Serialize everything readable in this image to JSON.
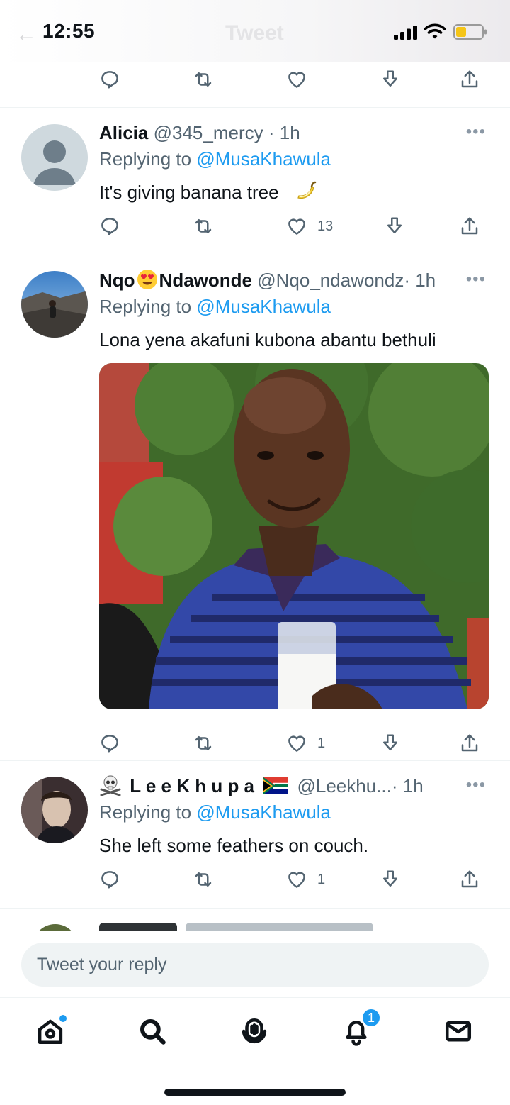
{
  "status_bar": {
    "time": "12:55",
    "ghost_title": "Tweet",
    "battery_color": "#f5c518"
  },
  "tweets": [
    {
      "name": "Alicia",
      "handle": "@345_mercy",
      "time": "· 1h",
      "replying_prefix": "Replying to",
      "replying_to": "@MusaKhawula",
      "text": "It's giving banana tree",
      "emoji_icon": "banana-icon",
      "like_count": "13"
    },
    {
      "name_part1": "Nqo",
      "name_part2": "Ndawonde",
      "name_emoji_icon": "heart-eyes-icon",
      "handle": "@Nqo_ndawondz",
      "time": "· 1h",
      "replying_prefix": "Replying to",
      "replying_to": "@MusaKhawula",
      "text": "Lona yena akafuni kubona abantu bethuli",
      "like_count": "1"
    },
    {
      "name": "L e e K h u p a",
      "name_prefix_icon": "skull-crossbones-icon",
      "name_suffix_icon": "south-africa-flag-icon",
      "handle": "@Leekhu...",
      "time": "· 1h",
      "replying_prefix": "Replying to",
      "replying_to": "@MusaKhawula",
      "text": "She left some feathers on couch.",
      "like_count": "1"
    }
  ],
  "reply_bar": {
    "placeholder": "Tweet your reply"
  },
  "tab_bar": {
    "notifications_badge": "1"
  },
  "colors": {
    "accent": "#1d9bf0",
    "text": "#0f1419",
    "muted": "#536471"
  }
}
